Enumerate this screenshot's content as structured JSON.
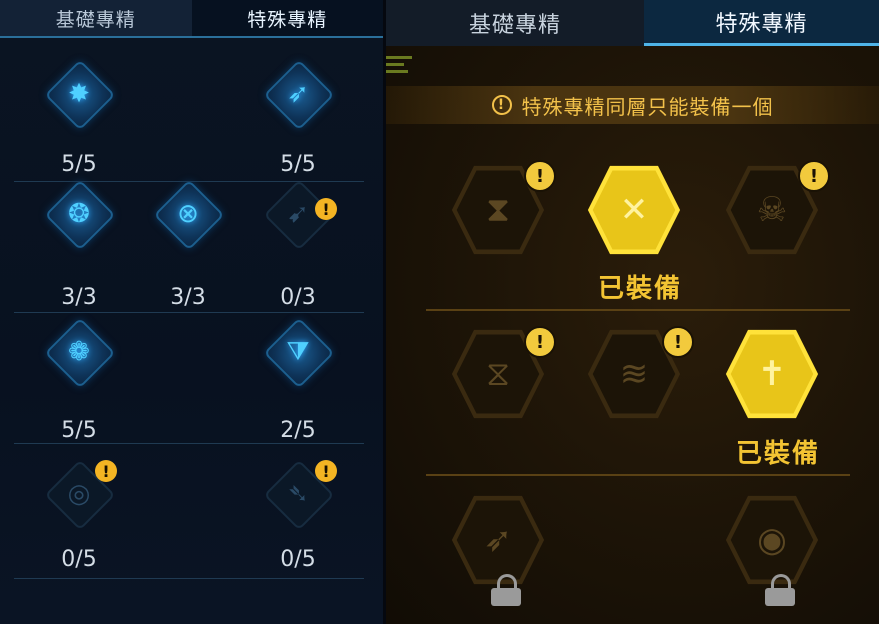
{
  "left_panel": {
    "tabs": [
      {
        "label": "基礎專精",
        "active": false
      },
      {
        "label": "特殊專精",
        "active": true
      }
    ],
    "nodes": [
      {
        "icon": "rocket-burst-icon",
        "count": "5/5",
        "dim": false,
        "warning": false
      },
      {
        "icon": "spear-plus-icon",
        "count": "5/5",
        "dim": false,
        "warning": false
      },
      {
        "icon": "flaming-bird-icon",
        "count": "3/3",
        "dim": false,
        "warning": false
      },
      {
        "icon": "target-cross-icon",
        "count": "3/3",
        "dim": false,
        "warning": false
      },
      {
        "icon": "spear-circle-icon",
        "count": "0/3",
        "dim": true,
        "warning": true
      },
      {
        "icon": "swirl-shield-icon",
        "count": "5/5",
        "dim": false,
        "warning": false
      },
      {
        "icon": "triangle-pillar-icon",
        "count": "2/5",
        "dim": false,
        "warning": false
      },
      {
        "icon": "gear-ring-icon",
        "count": "0/5",
        "dim": true,
        "warning": true
      },
      {
        "icon": "arrow-dash-icon",
        "count": "0/5",
        "dim": true,
        "warning": true
      }
    ],
    "warning_symbol": "!"
  },
  "right_panel": {
    "tabs": [
      {
        "label": "基礎專精",
        "active": false
      },
      {
        "label": "特殊專精",
        "active": true
      }
    ],
    "banner": {
      "icon": "info-icon",
      "symbol": "!",
      "text": "特殊專精同層只能裝備一個"
    },
    "tier1": [
      {
        "icon": "hourglass-icon",
        "equipped": false,
        "warning": true
      },
      {
        "icon": "crossed-blades-icon",
        "equipped": true,
        "warning": false
      },
      {
        "icon": "beast-skull-icon",
        "equipped": false,
        "warning": true
      }
    ],
    "tier2": [
      {
        "icon": "hourglass-blades-icon",
        "equipped": false,
        "warning": true
      },
      {
        "icon": "spring-coil-icon",
        "equipped": false,
        "warning": true
      },
      {
        "icon": "cross-shield-icon",
        "equipped": true,
        "warning": false
      }
    ],
    "tier3": [
      {
        "icon": "arrow-burst-icon",
        "locked": true
      },
      {
        "icon": "ring-core-icon",
        "locked": true
      }
    ],
    "equipped_label": "已裝備",
    "warning_symbol": "!",
    "colors": {
      "accent": "#f3c433",
      "equipped_hex": "#ffe23a",
      "blue_glow": "#4fd0ff"
    }
  }
}
